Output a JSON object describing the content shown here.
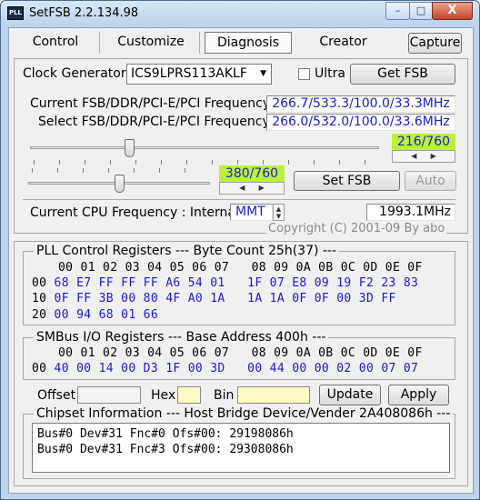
{
  "window": {
    "title": "SetFSB 2.2.134.98",
    "icon_text": "PLL",
    "minimize": "–",
    "maximize": "□",
    "close": "X"
  },
  "tabs": [
    {
      "label": "Control",
      "active": false
    },
    {
      "label": "Customize",
      "active": false
    },
    {
      "label": "Diagnosis",
      "active": true
    },
    {
      "label": "Creator",
      "active": false
    }
  ],
  "capture_button": "Capture",
  "clock": {
    "label": "Clock Generator",
    "selected": "ICS9LPRS113AKLF",
    "ultra_label": "Ultra",
    "ultra_checked": false,
    "get_fsb": "Get FSB"
  },
  "freq": {
    "current_label": "Current FSB/DDR/PCI-E/PCI Frequency",
    "current_value": "266.7/533.3/100.0/33.3MHz",
    "select_label": "Select FSB/DDR/PCI-E/PCI Frequency",
    "select_value": "266.0/532.0/100.0/33.6MHz",
    "slider1_value": "216/760",
    "slider1_fraction": 0.284,
    "slider2_value": "380/760",
    "slider2_fraction": 0.5,
    "set_fsb": "Set FSB",
    "auto": "Auto"
  },
  "cpu": {
    "label": "Current CPU Frequency : Internal",
    "mode": "MMT",
    "value": "1993.1MHz",
    "copyright": "Copyright (C) 2001-09 By abo"
  },
  "pll": {
    "title": "PLL Control Registers  --- Byte Count 25h(37) ---",
    "header": "00 01 02 03 04 05 06 07   08 09 0A 0B 0C 0D 0E 0F",
    "rows": [
      {
        "addr": "00",
        "data": "68 E7 FF FF FF A6 54 01   1F 07 E8 09 19 F2 23 83"
      },
      {
        "addr": "10",
        "data": "0F FF 3B 00 80 4F A0 1A   1A 1A 0F 0F 00 3D FF"
      },
      {
        "addr": "20",
        "data": "00 94 68 01 66"
      }
    ]
  },
  "smbus": {
    "title": "SMBus I/O Registers  --- Base Address 400h ---",
    "header": "00 01 02 03 04 05 06 07   08 09 0A 0B 0C 0D 0E 0F",
    "rows": [
      {
        "addr": "00",
        "data": "40 00 14 00 D3 1F 00 3D   00 44 00 00 02 00 07 07"
      }
    ]
  },
  "offset_row": {
    "offset_label": "Offset",
    "hex_label": "Hex",
    "bin_label": "Bin",
    "update": "Update",
    "apply": "Apply"
  },
  "chipset": {
    "title": "Chipset Information  --- Host Bridge Device/Vender 2A408086h ---",
    "lines": [
      "Bus#0 Dev#31 Fnc#0 Ofs#00: 29198086h",
      "Bus#0 Dev#31 Fnc#3 Ofs#00: 29308086h"
    ]
  }
}
